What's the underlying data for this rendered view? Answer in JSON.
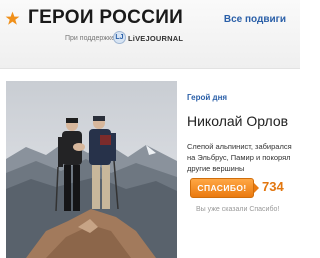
{
  "header": {
    "title": "ГЕРОИ РОССИИ",
    "all_link": "Все подвиги",
    "support_text": "При поддержке",
    "partner_mark": "LJ",
    "partner": "LiVEJOURNAL"
  },
  "hero": {
    "kicker": "Герой дня",
    "name": "Николай Орлов",
    "description": "Слепой альпинист, забирался на Эльбрус, Памир и покорял другие вершины",
    "thanks_label": "СПАСИБО!",
    "thanks_count": "734",
    "note": "Вы уже сказали Спасибо!"
  },
  "icons": {
    "header_star": "star-icon",
    "partner_logo": "livejournal-logo"
  },
  "colors": {
    "accent_orange": "#f0901a",
    "link_blue": "#2a5fa8"
  }
}
